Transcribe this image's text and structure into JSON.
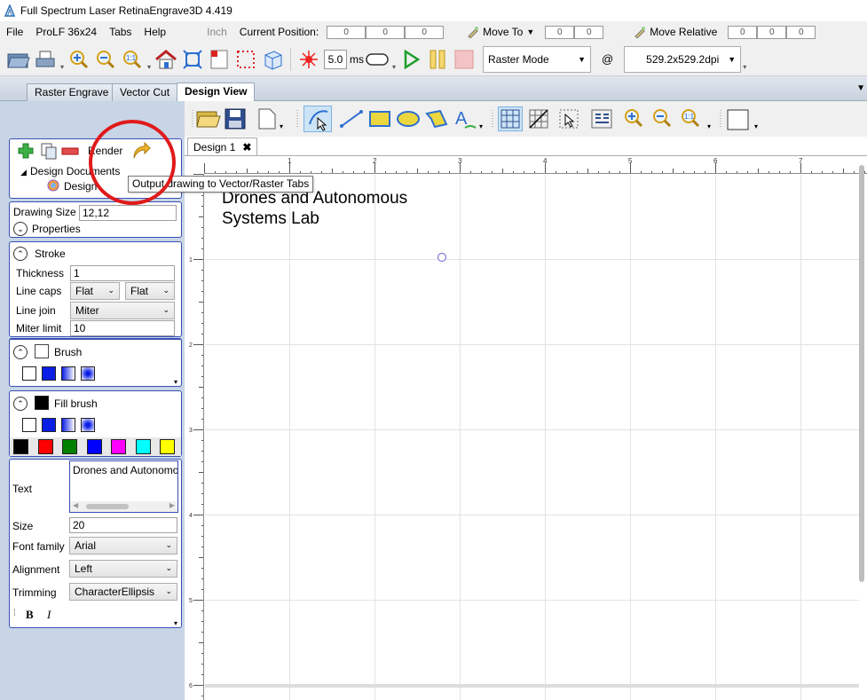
{
  "window": {
    "title": "Full Spectrum Laser RetinaEngrave3D 4.419"
  },
  "menu": {
    "items": [
      "File",
      "ProLF 36x24",
      "Tabs",
      "Help"
    ],
    "inch_label": "Inch",
    "current_position_label": "Current Position:",
    "current_position_values": [
      "0",
      "0",
      "0"
    ],
    "move_to_label": "Move To",
    "move_to_values": [
      "0",
      "0"
    ],
    "move_relative_label": "Move Relative",
    "move_relative_values": [
      "0",
      "0",
      "0"
    ]
  },
  "toolbar": {
    "exposure_value": "5.0",
    "exposure_unit": "ms",
    "mode_select": "Raster Mode",
    "at_symbol": "@",
    "dpi_value": "529.2x529.2dpi"
  },
  "tabs": [
    {
      "label": "Raster Engrave",
      "active": false
    },
    {
      "label": "Vector Cut",
      "active": false
    },
    {
      "label": "Design View",
      "active": true
    }
  ],
  "design_tree": {
    "render_label": "Render",
    "root_label": "Design Documents",
    "child_label": "Design"
  },
  "tooltip": {
    "text": "Output drawing to Vector/Raster Tabs"
  },
  "drawing_size": {
    "label": "Drawing Size",
    "value": "12,12",
    "properties_label": "Properties"
  },
  "stroke": {
    "header": "Stroke",
    "thickness_label": "Thickness",
    "thickness_value": "1",
    "line_caps_label": "Line caps",
    "line_caps_start": "Flat",
    "line_caps_end": "Flat",
    "line_join_label": "Line join",
    "line_join_value": "Miter",
    "miter_limit_label": "Miter limit",
    "miter_limit_value": "10"
  },
  "brush": {
    "header": "Brush"
  },
  "fill_brush": {
    "header": "Fill brush",
    "palette": [
      "#000000",
      "#ff0000",
      "#008000",
      "#0000ff",
      "#ff00ff",
      "#00ffff",
      "#ffff00"
    ]
  },
  "text_props": {
    "text_label": "Text",
    "text_value": "Drones and Autonomo",
    "size_label": "Size",
    "size_value": "20",
    "font_family_label": "Font family",
    "font_family_value": "Arial",
    "alignment_label": "Alignment",
    "alignment_value": "Left",
    "trimming_label": "Trimming",
    "trimming_value": "CharacterEllipsis",
    "bold_label": "B",
    "italic_label": "I"
  },
  "document": {
    "tab_label": "Design 1",
    "close_label": "✖",
    "canvas_line1": "Drones and Autonomous",
    "canvas_line2": "Systems Lab"
  },
  "ruler": {
    "h_labels": [
      "1",
      "2",
      "3",
      "4",
      "5",
      "6",
      "7"
    ],
    "v_labels": [
      "1",
      "2",
      "3",
      "4",
      "5",
      "6"
    ]
  },
  "colors": {
    "accent_panel": "#c7d5e6",
    "group_border": "#3a4fb4",
    "annotation_red": "#e01a1a"
  }
}
